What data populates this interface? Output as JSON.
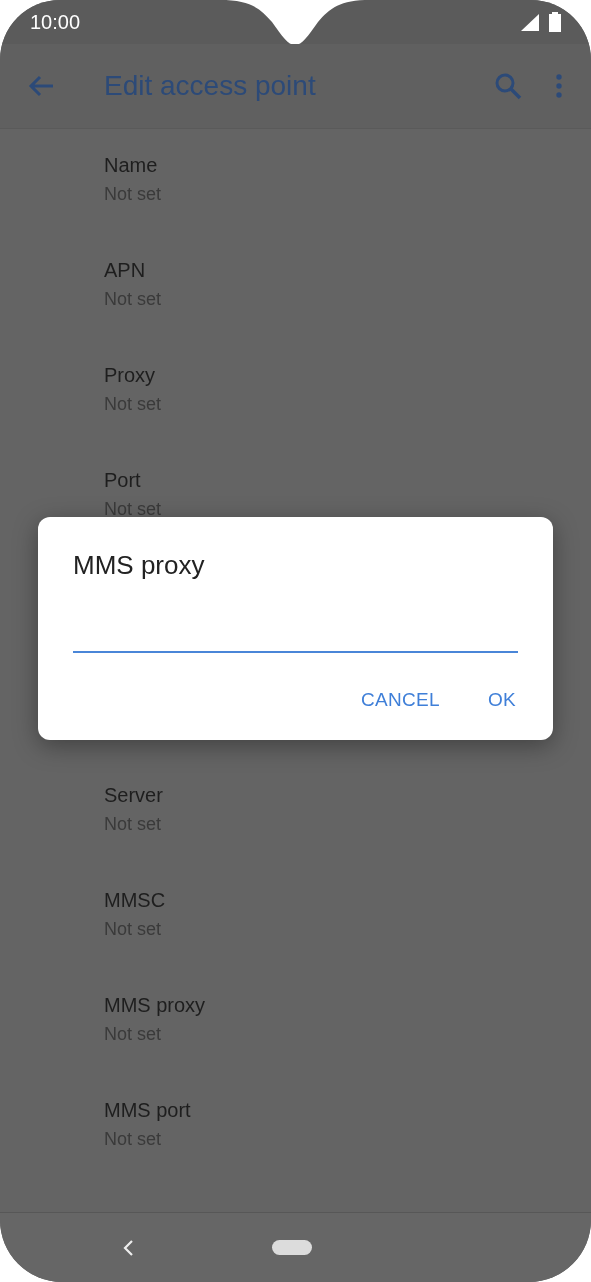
{
  "status_bar": {
    "time": "10:00"
  },
  "toolbar": {
    "title": "Edit access point"
  },
  "settings": [
    {
      "title": "Name",
      "summary": "Not set"
    },
    {
      "title": "APN",
      "summary": "Not set"
    },
    {
      "title": "Proxy",
      "summary": "Not set"
    },
    {
      "title": "Port",
      "summary": "Not set"
    },
    {
      "title": "Server",
      "summary": "Not set"
    },
    {
      "title": "MMSC",
      "summary": "Not set"
    },
    {
      "title": "MMS proxy",
      "summary": "Not set"
    },
    {
      "title": "MMS port",
      "summary": "Not set"
    }
  ],
  "dialog": {
    "title": "MMS proxy",
    "input": {
      "focused": true
    },
    "buttons": [
      "CANCEL",
      "OK"
    ]
  }
}
